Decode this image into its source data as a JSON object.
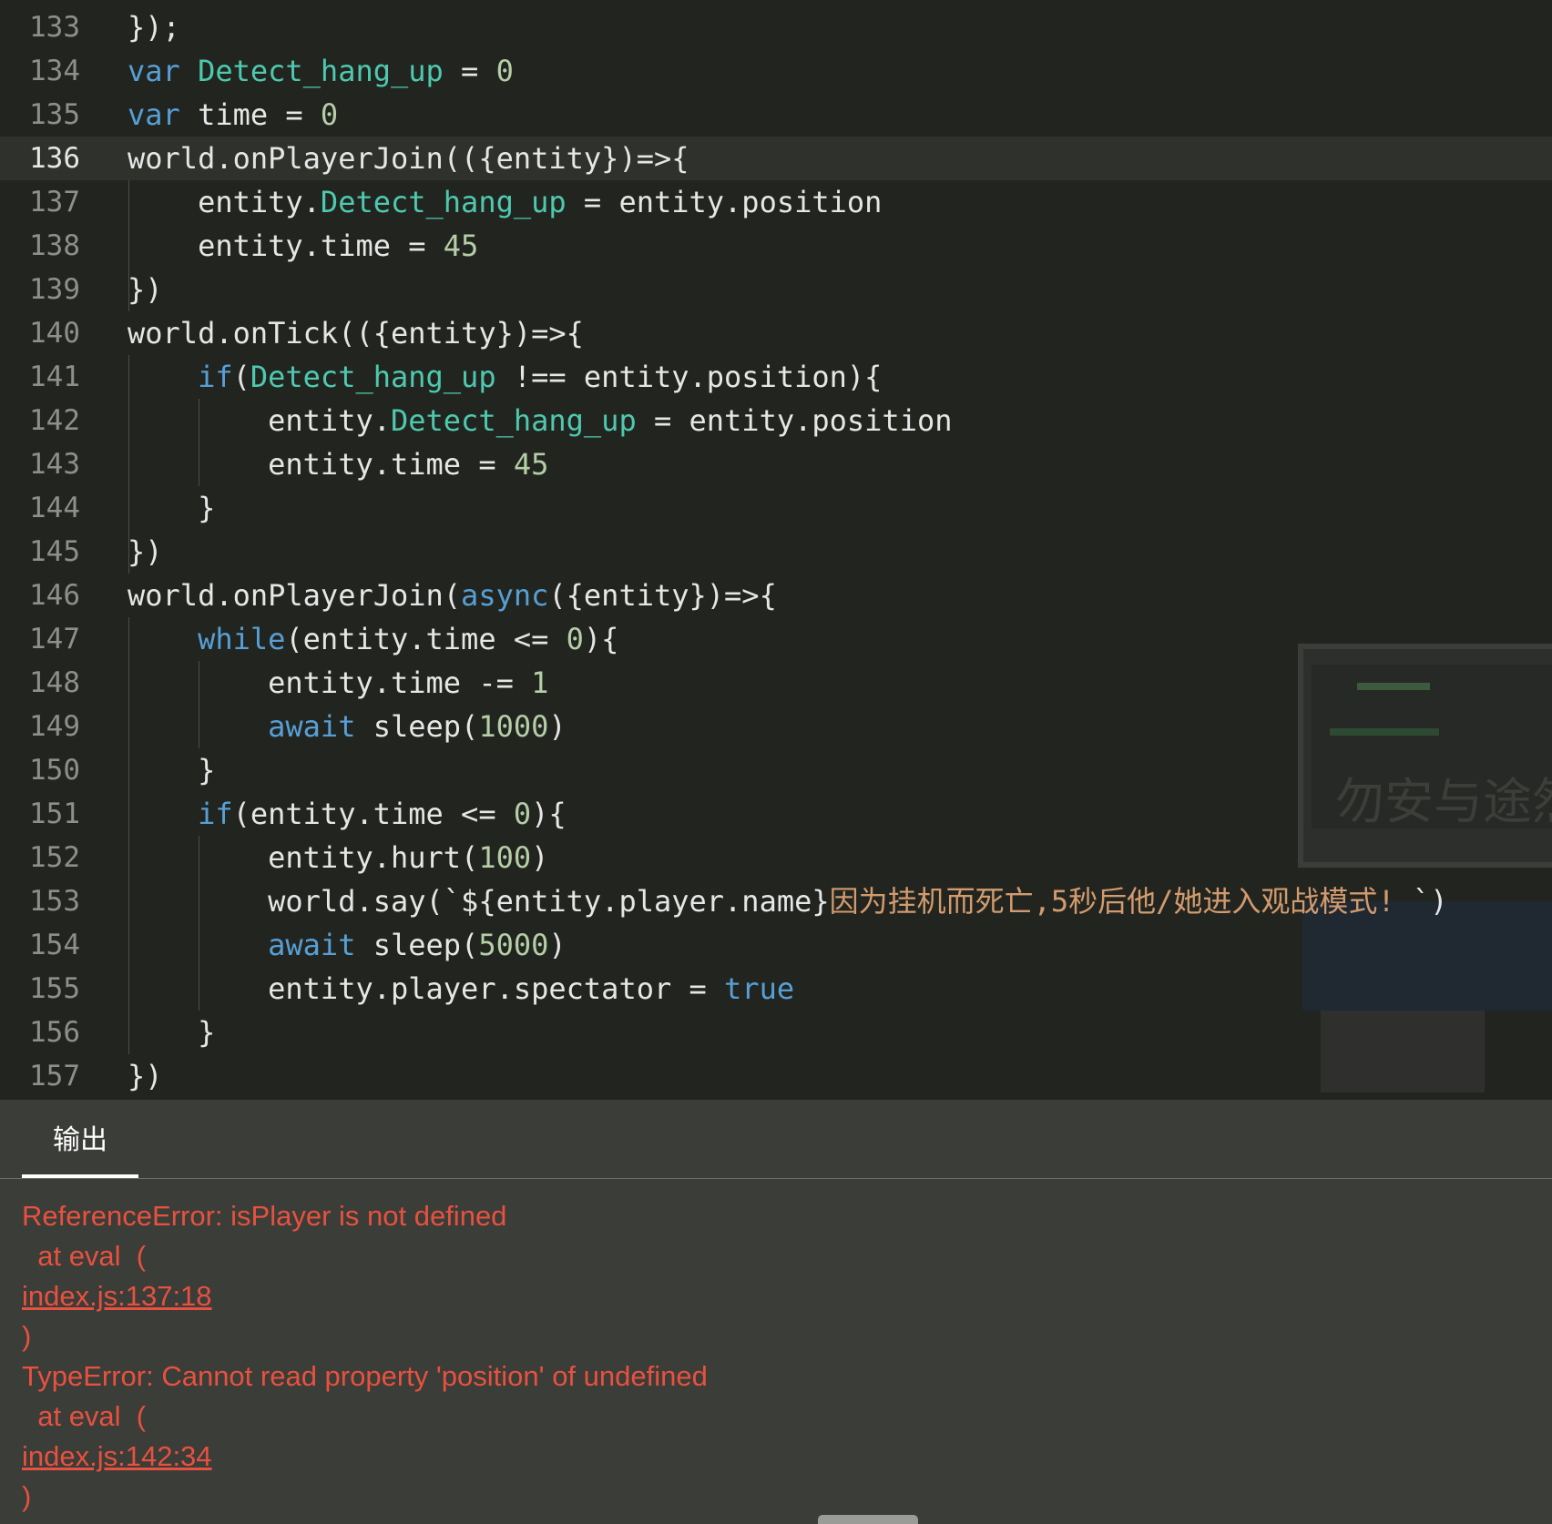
{
  "editor": {
    "active_line": "136",
    "lines": [
      {
        "num": "133",
        "text": "});"
      },
      {
        "num": "134",
        "text": "var Detect_hang_up = 0"
      },
      {
        "num": "135",
        "text": "var time = 0"
      },
      {
        "num": "136",
        "text": "world.onPlayerJoin(({entity})=>{"
      },
      {
        "num": "137",
        "text": "    entity.Detect_hang_up = entity.position"
      },
      {
        "num": "138",
        "text": "    entity.time = 45"
      },
      {
        "num": "139",
        "text": "})"
      },
      {
        "num": "140",
        "text": "world.onTick(({entity})=>{"
      },
      {
        "num": "141",
        "text": "    if(Detect_hang_up !== entity.position){"
      },
      {
        "num": "142",
        "text": "        entity.Detect_hang_up = entity.position"
      },
      {
        "num": "143",
        "text": "        entity.time = 45"
      },
      {
        "num": "144",
        "text": "    }"
      },
      {
        "num": "145",
        "text": "})"
      },
      {
        "num": "146",
        "text": "world.onPlayerJoin(async({entity})=>{"
      },
      {
        "num": "147",
        "text": "    while(entity.time <= 0){"
      },
      {
        "num": "148",
        "text": "        entity.time -= 1"
      },
      {
        "num": "149",
        "text": "        await sleep(1000)"
      },
      {
        "num": "150",
        "text": "    }"
      },
      {
        "num": "151",
        "text": "    if(entity.time <= 0){"
      },
      {
        "num": "152",
        "text": "        entity.hurt(100)"
      },
      {
        "num": "153",
        "text": "        world.say(`${entity.player.name}因为挂机而死亡,5秒后他/她进入观战模式! `)"
      },
      {
        "num": "154",
        "text": "        await sleep(5000)"
      },
      {
        "num": "155",
        "text": "        entity.player.spectator = true"
      },
      {
        "num": "156",
        "text": "    }"
      },
      {
        "num": "157",
        "text": "})"
      }
    ],
    "watermark_text": "勿安与途然"
  },
  "output_panel": {
    "tab_label": "输出",
    "errors": [
      {
        "message": "ReferenceError: isPlayer is not defined",
        "at": "  at eval  (",
        "link": "index.js:137:18",
        "close": ")"
      },
      {
        "message": "TypeError: Cannot read property 'position' of undefined",
        "at": "  at eval  (",
        "link": "index.js:142:34",
        "close": ")"
      }
    ]
  },
  "colors": {
    "keyword": "#579fd6",
    "variable": "#4ec9b0",
    "number": "#b5cea8",
    "string": "#d29b6f",
    "error": "#e8513f"
  }
}
